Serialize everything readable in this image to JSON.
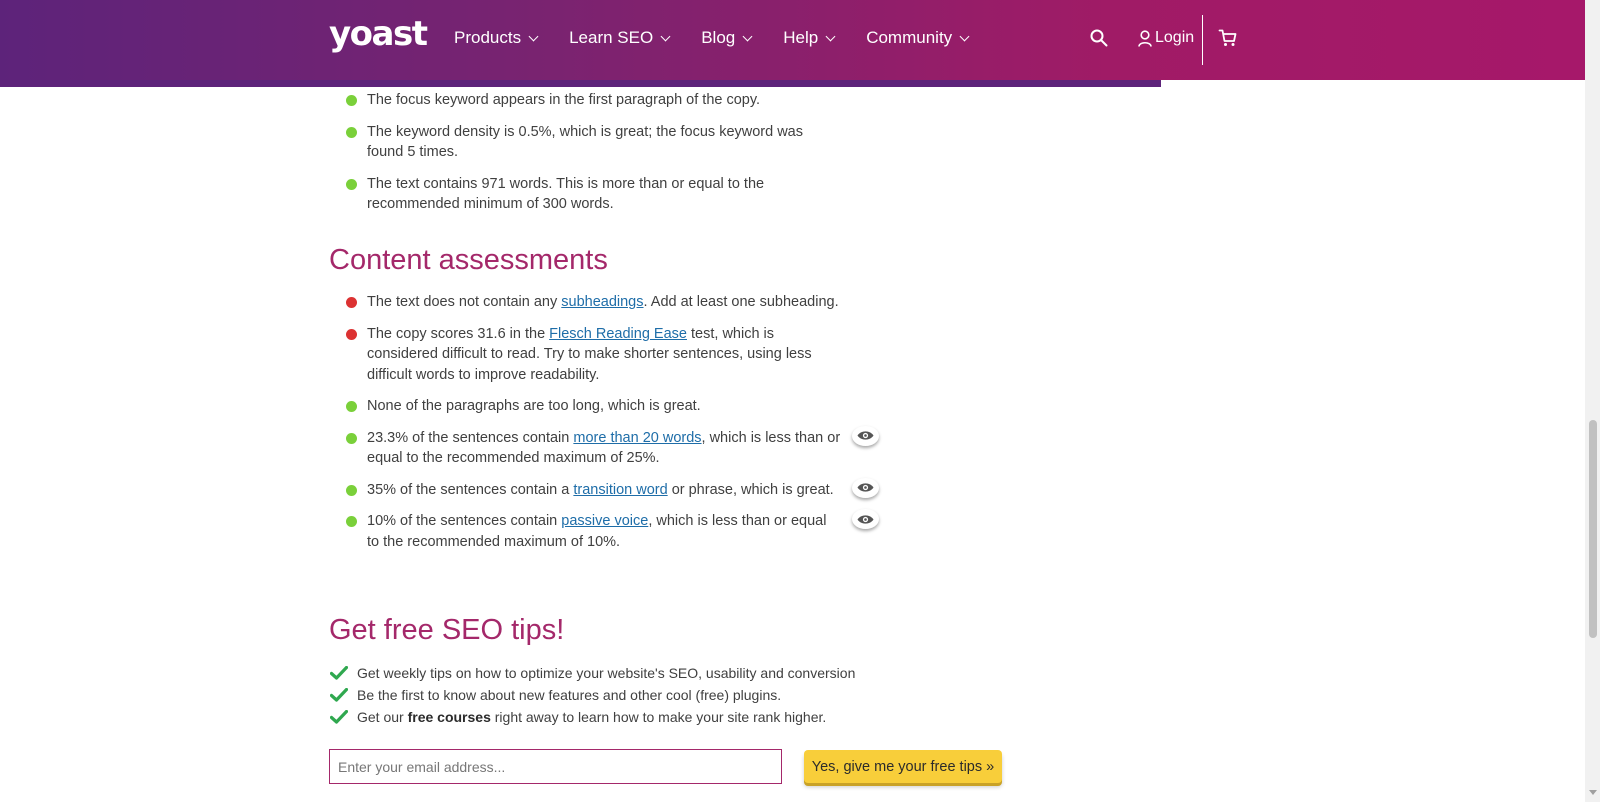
{
  "header": {
    "logo": "yoast",
    "nav": [
      {
        "label": "Products"
      },
      {
        "label": "Learn SEO"
      },
      {
        "label": "Blog"
      },
      {
        "label": "Help"
      },
      {
        "label": "Community"
      }
    ],
    "login_label": "Login"
  },
  "seo_list": [
    {
      "status": "good",
      "text": "The focus keyword appears in the first paragraph of the copy."
    },
    {
      "status": "good",
      "text": "The keyword density is 0.5%, which is great; the focus keyword was found 5 times."
    },
    {
      "status": "good",
      "text": "The text contains 971 words. This is more than or equal to the recommended minimum of 300 words."
    }
  ],
  "content_assessments": {
    "heading": "Content assessments",
    "items": [
      {
        "status": "bad",
        "before": "The text does not contain any ",
        "link": "subheadings",
        "after": ". Add at least one subheading."
      },
      {
        "status": "bad",
        "before": "The copy scores 31.6 in the ",
        "link": "Flesch Reading Ease",
        "after": " test, which is considered difficult to read. Try to make shorter sentences, using less difficult words to improve readability."
      },
      {
        "status": "good",
        "before": "None of the paragraphs are too long, which is great.",
        "link": "",
        "after": ""
      },
      {
        "status": "good",
        "before": "23.3% of the sentences contain ",
        "link": "more than 20 words",
        "after": ", which is less than or equal to the recommended maximum of 25%."
      },
      {
        "status": "good",
        "before": "35% of the sentences contain a ",
        "link": "transition word",
        "after": " or phrase, which is great."
      },
      {
        "status": "good",
        "before": "10% of the sentences contain ",
        "link": "passive voice",
        "after": ", which is less than or equal to the recommended maximum of 10%."
      }
    ]
  },
  "tips": {
    "heading": "Get free SEO tips!",
    "items": [
      {
        "before": "Get weekly tips on how to optimize your website's SEO, usability and conversion",
        "bold": "",
        "after": ""
      },
      {
        "before": "Be the first to know about new features and other cool (free) plugins.",
        "bold": "",
        "after": ""
      },
      {
        "before": "Get our ",
        "bold": "free courses",
        "after": " right away to learn how to make your site rank higher."
      }
    ],
    "email_placeholder": "Enter your email address...",
    "submit_label": "Yes, give me your free tips »"
  },
  "colors": {
    "good": "#7ad03a",
    "bad": "#dc3232",
    "heading": "#a4286a",
    "button": "#f8ce3a"
  }
}
